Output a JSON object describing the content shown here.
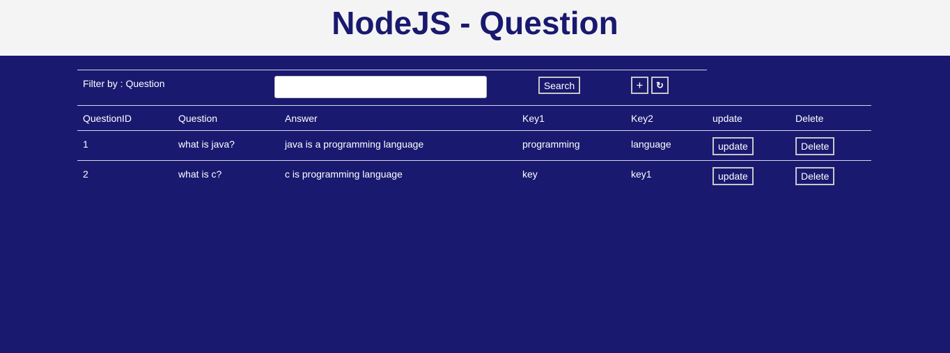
{
  "header": {
    "title": "NodeJS - Question"
  },
  "filter": {
    "label": "Filter by : Question",
    "input_value": "",
    "search_label": "Search",
    "add_label": "+",
    "refresh_label": "↻"
  },
  "table": {
    "columns": [
      "QuestionID",
      "Question",
      "Answer",
      "Key1",
      "Key2",
      "update",
      "Delete"
    ],
    "rows": [
      {
        "id": "1",
        "question": "what is java?",
        "answer": "java is a programming language",
        "key1": "programming",
        "key2": "language",
        "update_label": "update",
        "delete_label": "Delete"
      },
      {
        "id": "2",
        "question": "what is c?",
        "answer": "c is programming language",
        "key1": "key",
        "key2": "key1",
        "update_label": "update",
        "delete_label": "Delete"
      }
    ]
  },
  "colors": {
    "background": "#191970",
    "header_background": "#f4f4f4",
    "title_color": "#191970"
  }
}
